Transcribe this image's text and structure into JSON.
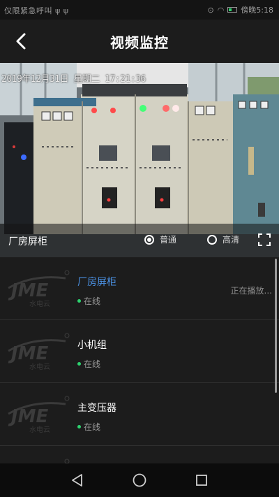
{
  "status_bar": {
    "carrier": "仅限紧急呼叫 ψ ψ",
    "time": "傍晚5:18",
    "icons": [
      "location-icon",
      "wifi-icon",
      "battery-icon"
    ],
    "battery_color": "#2dd36f"
  },
  "header": {
    "title": "视频监控",
    "back_icon": "chevron-left-icon"
  },
  "video": {
    "osd_text": "2019年12月31日  星期二  17:21:36",
    "camera_name": "厂房屏柜",
    "quality_normal": "普通",
    "quality_hd": "高清",
    "quality_selected": "normal",
    "fullscreen_icon": "fullscreen-icon"
  },
  "camera_list": {
    "items": [
      {
        "name": "厂房屏柜",
        "status": "在线",
        "active": true,
        "playing": "正在播放..."
      },
      {
        "name": "小机组",
        "status": "在线",
        "active": false
      },
      {
        "name": "主变压器",
        "status": "在线",
        "active": false
      }
    ],
    "logo_icon": "jme-hydropower-cloud-logo",
    "online_color": "#2dd36f",
    "active_color": "#4a8fe0"
  },
  "nav_bar": {
    "icons": [
      "back-triangle-icon",
      "home-circle-icon",
      "recents-square-icon"
    ]
  }
}
